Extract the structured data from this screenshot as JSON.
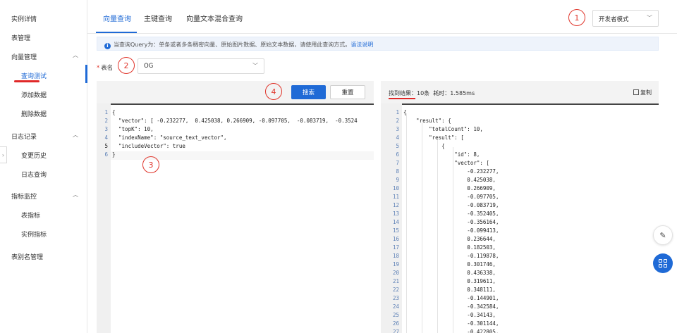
{
  "sidebar": {
    "items": [
      {
        "label": "实例详情"
      },
      {
        "label": "表管理"
      },
      {
        "label": "向量管理"
      },
      {
        "label": "查询测试"
      },
      {
        "label": "添加数据"
      },
      {
        "label": "删除数据"
      },
      {
        "label": "日志记录"
      },
      {
        "label": "变更历史"
      },
      {
        "label": "日志查询"
      },
      {
        "label": "指标监控"
      },
      {
        "label": "表指标"
      },
      {
        "label": "实例指标"
      },
      {
        "label": "表别名管理"
      }
    ],
    "active": "查询测试"
  },
  "tabs": [
    {
      "label": "向量查询",
      "active": true
    },
    {
      "label": "主键查询",
      "active": false
    },
    {
      "label": "向量文本混合查询",
      "active": false
    }
  ],
  "mode_select": {
    "value": "开发者模式"
  },
  "info": {
    "text": "当查询Query为：单条或者多条稠密向量、原始图片数据、原始文本数据，请使用此查询方式。",
    "link": "语法说明"
  },
  "table_field": {
    "label": "表名",
    "value": "OG"
  },
  "buttons": {
    "search": "搜索",
    "reset": "重置",
    "copy": "复制"
  },
  "result_summary": {
    "found_label": "找到结果：",
    "count": "10条",
    "time": "耗时：1.585ms"
  },
  "annotations": [
    "1",
    "2",
    "3",
    "4"
  ],
  "left_code": [
    "{",
    "  \"vector\": [ -0.232277,  0.425038, 0.266909, -0.097705,  -0.083719,  -0.3524",
    "  \"topK\": 10,",
    "  \"indexName\": \"source_text_vector\",",
    "  \"includeVector\": true",
    "}"
  ],
  "right_code": [
    "{",
    "    \"result\": {",
    "        \"totalCount\": 10,",
    "        \"result\": [",
    "            {",
    "                \"id\": 8,",
    "                \"vector\": [",
    "                    -0.232277,",
    "                    0.425038,",
    "                    0.266909,",
    "                    -0.097705,",
    "                    -0.083719,",
    "                    -0.352405,",
    "                    -0.356164,",
    "                    -0.099413,",
    "                    0.236644,",
    "                    0.182503,",
    "                    -0.119878,",
    "                    0.301746,",
    "                    0.436338,",
    "                    0.319611,",
    "                    0.348111,",
    "                    -0.144901,",
    "                    -0.342584,",
    "                    -0.34143,",
    "                    -0.301144,",
    "                    -0.422805,"
  ],
  "colors": {
    "accent": "#1f6ad6",
    "annotation": "#e0352b"
  },
  "icons": {
    "collapse": "chevron-right-icon",
    "edit": "edit-icon",
    "apps": "grid-icon",
    "info": "info-icon",
    "copy": "copy-icon"
  }
}
